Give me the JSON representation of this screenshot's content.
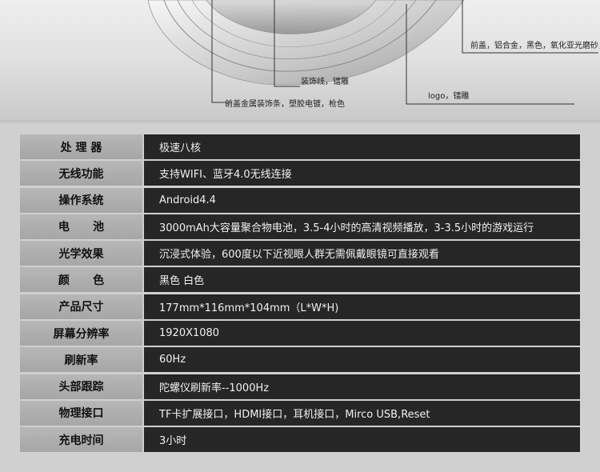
{
  "callouts": {
    "front_cover_trim": "前盖金属装饰条，塑胶电镀，枪色",
    "decor_line": "装饰线，镭雕",
    "logo": "logo，镭雕",
    "front_cover_material": "前盖，铝合金，黑色，氧化亚光磨砂，"
  },
  "specs": [
    {
      "label": "处 理 器",
      "value": "极速八核"
    },
    {
      "label": "无线功能",
      "value": "支持WIFI、蓝牙4.0无线连接"
    },
    {
      "label": "操作系统",
      "value": "Android4.4"
    },
    {
      "label": "电      池",
      "value": "3000mAh大容量聚合物电池，3.5-4小时的高清视频播放，3-3.5小时的游戏运行"
    },
    {
      "label": "光学效果",
      "value": "沉浸式体验，600度以下近视眼人群无需佩戴眼镜可直接观看"
    },
    {
      "label": "颜      色",
      "value": "黑色 白色"
    },
    {
      "label": "产品尺寸",
      "value": "177mm*116mm*104mm（L*W*H)"
    },
    {
      "label": "屏幕分辨率",
      "value": "1920X1080"
    },
    {
      "label": "刷新率",
      "value": "60Hz"
    },
    {
      "label": "头部跟踪",
      "value": "陀螺仪刷新率--1000Hz"
    },
    {
      "label": "物理接口",
      "value": "TF卡扩展接口，HDMI接口，耳机接口，Mirco USB,Reset"
    },
    {
      "label": "充电时间",
      "value": "3小时"
    }
  ]
}
